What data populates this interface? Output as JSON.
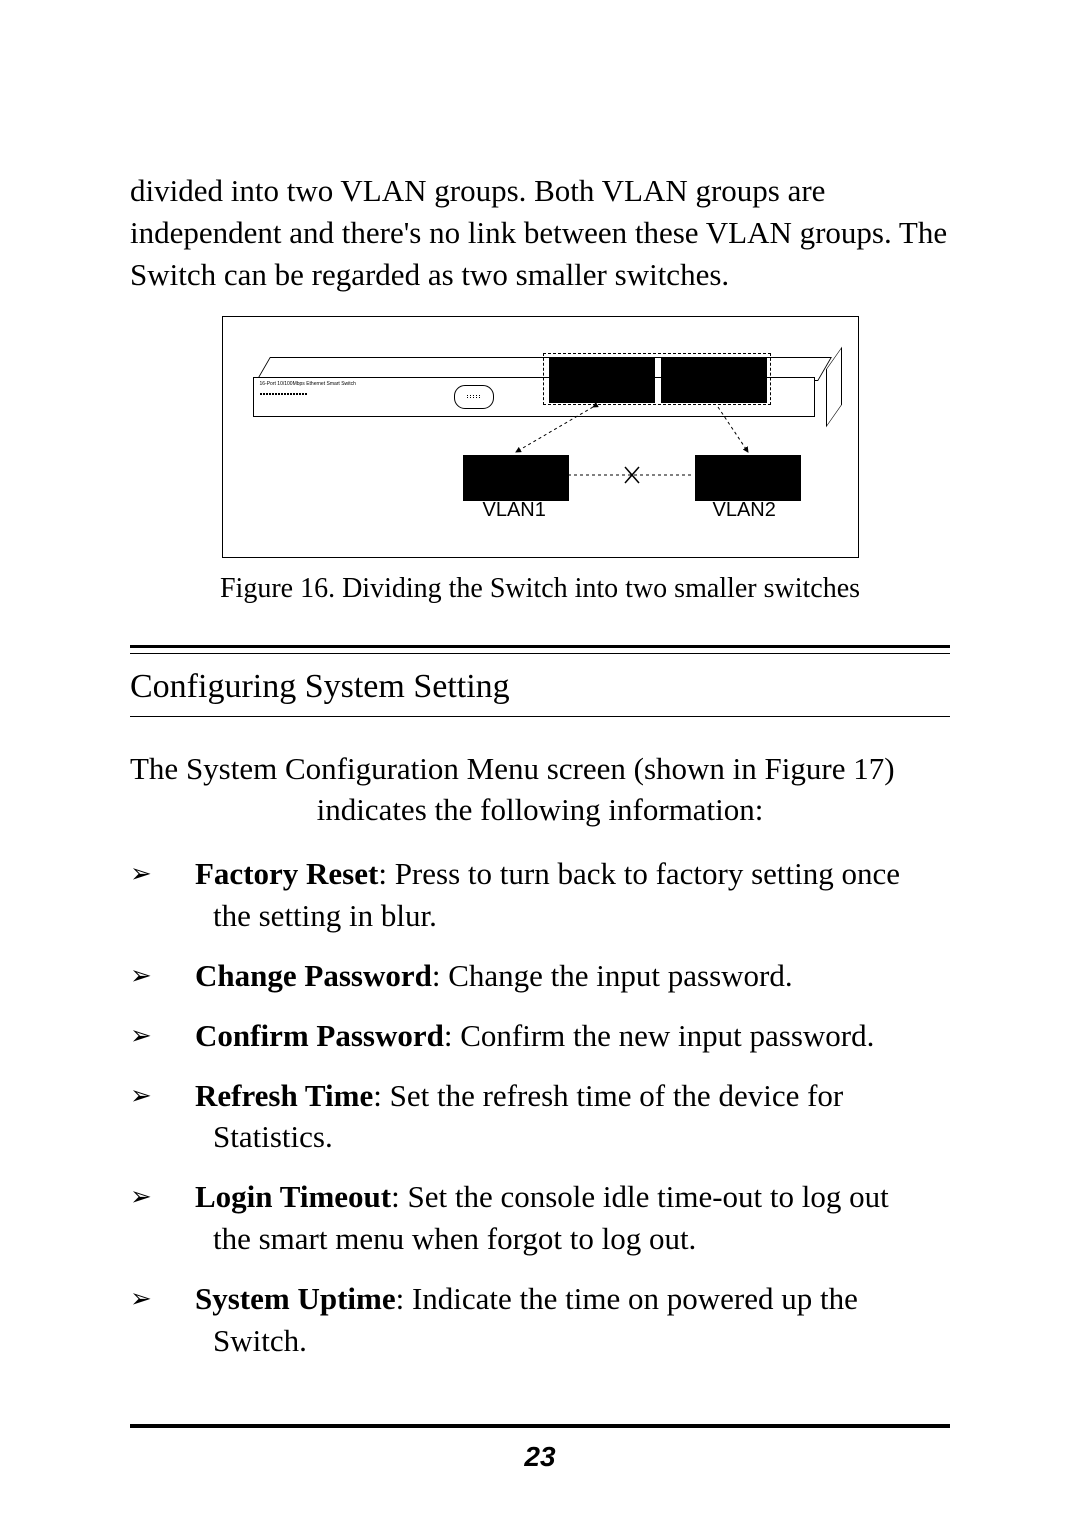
{
  "intro": "divided into two VLAN groups. Both VLAN groups are independent and there's no link between these VLAN groups. The Switch can be regarded as two smaller switches.",
  "figure": {
    "switch_label": "16-Port 10/100Mbps Ethernet Smart Switch",
    "vlan1_label": "VLAN1",
    "vlan2_label": "VLAN2",
    "caption": "Figure 16. Dividing the Switch into two smaller switches"
  },
  "section_title": "Configuring System Setting",
  "section_intro_line1": "The System Configuration Menu screen (shown in Figure 17)",
  "section_intro_line2": "indicates the following information:",
  "bullets": [
    {
      "term": "Factory Reset",
      "desc": ": Press to turn back to factory setting once",
      "cont": "the setting in blur."
    },
    {
      "term": "Change Password",
      "desc": ":  Change the input password.",
      "cont": ""
    },
    {
      "term": "Confirm Password",
      "desc": ": Confirm the new input password.",
      "cont": ""
    },
    {
      "term": "Refresh Time",
      "desc": ": Set the refresh time of the device for",
      "cont": "Statistics."
    },
    {
      "term": "Login Timeout",
      "desc": ": Set the console idle time-out to log out",
      "cont": "the smart menu when forgot to log out."
    },
    {
      "term": "System Uptime",
      "desc": ": Indicate the time on powered up the",
      "cont": "Switch."
    }
  ],
  "page_number": "23"
}
